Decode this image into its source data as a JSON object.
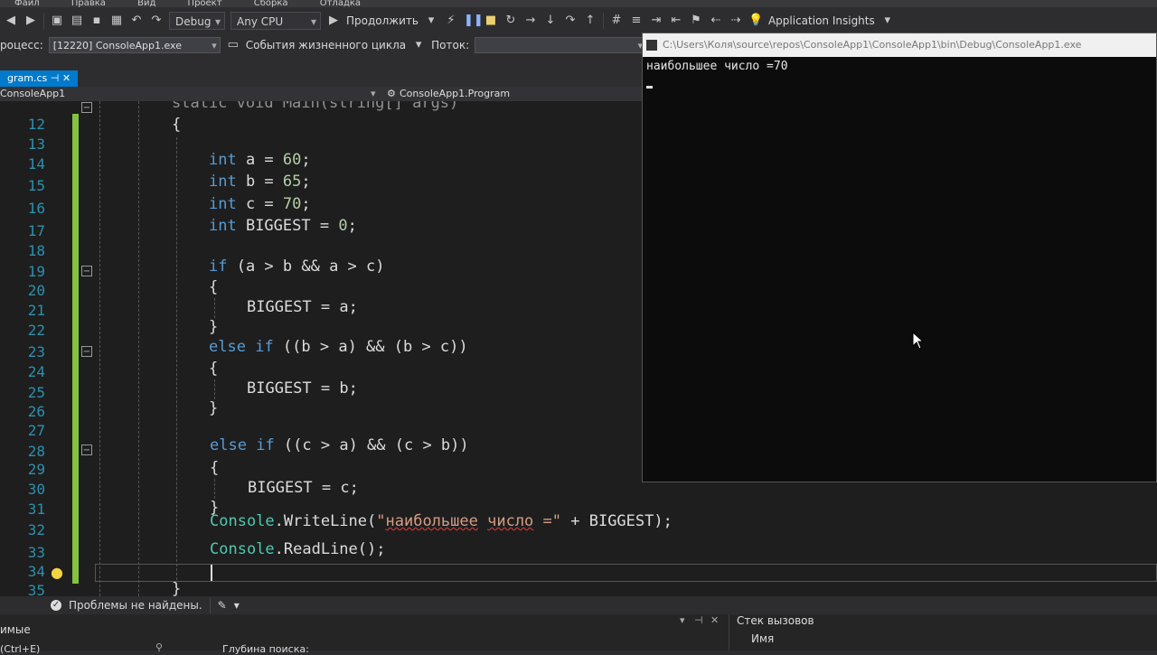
{
  "menu": [
    "Файл",
    "Правка",
    "Вид",
    "Проект",
    "Сборка",
    "Отладка"
  ],
  "toolbar": {
    "configuration": "Debug",
    "platform": "Any CPU",
    "continue_label": "Продолжить",
    "insights_label": "Application Insights"
  },
  "debugbar": {
    "process_label": "роцесс:",
    "process_value": "[12220] ConsoleApp1.exe",
    "lifecycle_label": "События жизненного цикла",
    "thread_label": "Поток:"
  },
  "editor": {
    "tab_label": "gram.cs",
    "nav_project": "ConsoleApp1",
    "nav_class": "ConsoleApp1.Program",
    "line_numbers": [
      "12",
      "13",
      "14",
      "15",
      "16",
      "17",
      "18",
      "19",
      "20",
      "21",
      "22",
      "23",
      "24",
      "25",
      "26",
      "27",
      "28",
      "29",
      "30",
      "31",
      "32",
      "33",
      "34",
      "35"
    ],
    "code": {
      "l11": "static void Main(string[] args)",
      "l12": "{",
      "l14": [
        "int",
        " a = ",
        "60",
        ";"
      ],
      "l15": [
        "int",
        " b = ",
        "65",
        ";"
      ],
      "l16": [
        "int",
        " c = ",
        "70",
        ";"
      ],
      "l17": [
        "int",
        " BIGGEST = ",
        "0",
        ";"
      ],
      "l19": [
        "if",
        " (a > b && a > c)"
      ],
      "l20": "{",
      "l21": "BIGGEST = a;",
      "l22": "}",
      "l23": [
        "else",
        "if",
        " ((b > a) && (b > c))"
      ],
      "l24": "{",
      "l25": "BIGGEST = b;",
      "l26": "}",
      "l28": [
        "else",
        "if",
        " ((c > a) && (c > b))"
      ],
      "l29": "{",
      "l30": "BIGGEST = c;",
      "l31": "}",
      "l32_type": "Console",
      "l32_method": ".WriteLine(",
      "l32_str_open": "\"",
      "l32_word1": "наибольшее",
      "l32_word2": "число",
      "l32_str_close": " =\"",
      "l32_tail": " + BIGGEST);",
      "l33_type": "Console",
      "l33_tail": ".ReadLine();",
      "l35": "}"
    }
  },
  "console": {
    "title": "C:\\Users\\Коля\\source\\repos\\ConsoleApp1\\ConsoleApp1\\bin\\Debug\\ConsoleApp1.exe",
    "output": "наибольшее число =70"
  },
  "status": {
    "problems": "Проблемы не найдены."
  },
  "bottom": {
    "left_title": "имые",
    "search_label": "(Ctrl+E)",
    "depth_label": "Глубина поиска:",
    "callstack_title": "Стек вызовов",
    "callstack_col": "Имя"
  }
}
